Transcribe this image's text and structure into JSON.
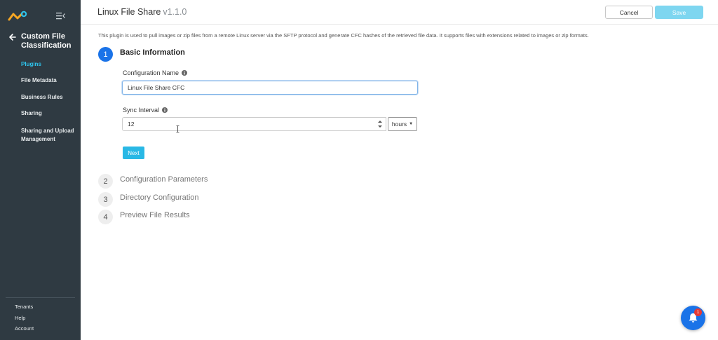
{
  "sidebar": {
    "section_title": "Custom File Classification",
    "items": [
      {
        "label": "Plugins",
        "active": true
      },
      {
        "label": "File Metadata"
      },
      {
        "label": "Business Rules"
      },
      {
        "label": "Sharing"
      },
      {
        "label": "Sharing and Upload Management"
      }
    ],
    "bottom_links": [
      "Tenants",
      "Help",
      "Account"
    ]
  },
  "header": {
    "title": "Linux File Share",
    "version": "v1.1.0",
    "cancel_label": "Cancel",
    "save_label": "Save"
  },
  "description": "This plugin is used to pull images or zip files from a remote Linux server via the SFTP protocol and generate CFC hashes of the retrieved file data. It supports files with extensions related to images or zip formats.",
  "steps": [
    {
      "number": "1",
      "label": "Basic Information",
      "active": true
    },
    {
      "number": "2",
      "label": "Configuration Parameters"
    },
    {
      "number": "3",
      "label": "Directory Configuration"
    },
    {
      "number": "4",
      "label": "Preview File Results"
    }
  ],
  "form": {
    "config_name_label": "Configuration Name",
    "config_name_value": "Linux File Share CFC",
    "sync_interval_label": "Sync Interval",
    "sync_interval_value": "12",
    "sync_unit": "hours",
    "next_label": "Next"
  },
  "notifications": {
    "count": "1"
  },
  "colors": {
    "sidebar_bg": "#2f3a42",
    "accent": "#2ec7f0",
    "primary": "#1a73e8",
    "badge": "#e53935"
  }
}
